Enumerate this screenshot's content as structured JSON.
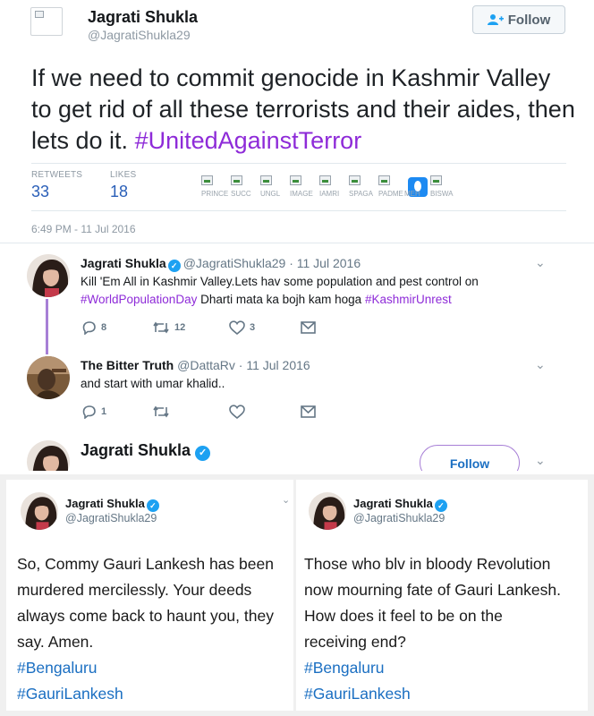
{
  "main_tweet": {
    "author_name": "Jagrati Shukla",
    "author_handle": "@JagratiShukla29",
    "follow_label": "Follow",
    "text_plain": "If we need to commit genocide in Kashmir Valley to get rid of all these terrorists and their aides, then lets do it. ",
    "hashtag": "#UnitedAgainstTerror",
    "retweets_label": "RETWEETS",
    "retweets_value": "33",
    "likes_label": "LIKES",
    "likes_value": "18",
    "liker_captions": [
      "PRINCE",
      "SUCC",
      "UNGL",
      "IMAGE",
      "IAMRI",
      "SPAGA",
      "PADME",
      "MEH",
      "BISWA"
    ],
    "timestamp": "6:49 PM - 11 Jul 2016"
  },
  "replies": [
    {
      "name": "Jagrati Shukla",
      "handle_date": "@JagratiShukla29 · 11 Jul 2016",
      "text_line1": "Kill 'Em All in Kashmir Valley.Lets hav some population and pest control on",
      "hashtag1": "#WorldPopulationDay",
      "text_mid": " Dharti mata ka bojh kam hoga ",
      "hashtag2": "#KashmirUnrest",
      "replies_count": "8",
      "retweets_count": "12",
      "likes_count": "3"
    },
    {
      "name": "The Bitter Truth",
      "handle_date": "@DattaRv · 11 Jul 2016",
      "text": "and start with umar khalid..",
      "replies_count": "1"
    },
    {
      "name": "Jagrati Shukla",
      "follow_label": "Follow"
    }
  ],
  "screenshots": [
    {
      "name": "Jagrati Shukla",
      "handle": "@JagratiShukla29",
      "lines": [
        "So, Commy Gauri Lankesh has been",
        "murdered mercilessly. Your deeds",
        "always come back to haunt you, they",
        "say. Amen."
      ],
      "tags": [
        "#Bengaluru",
        "#GauriLankesh"
      ]
    },
    {
      "name": "Jagrati Shukla",
      "handle": "@JagratiShukla29",
      "lines": [
        "Those who blv in bloody Revolution",
        "now mourning fate of Gauri Lankesh.",
        "How does it feel to be on the",
        "receiving end?"
      ],
      "tags": [
        "#Bengaluru",
        "#GauriLankesh"
      ]
    }
  ],
  "colors": {
    "hashtag_purple": "#8e2bd8",
    "link_blue": "#1b6fc2",
    "verified_blue": "#1da1f2",
    "thread_line": "#a77fd6"
  },
  "icons": [
    "user-plus-icon",
    "reply-icon",
    "retweet-icon",
    "like-icon",
    "message-icon",
    "chevron-down-icon",
    "verified-icon",
    "broken-image-icon"
  ]
}
